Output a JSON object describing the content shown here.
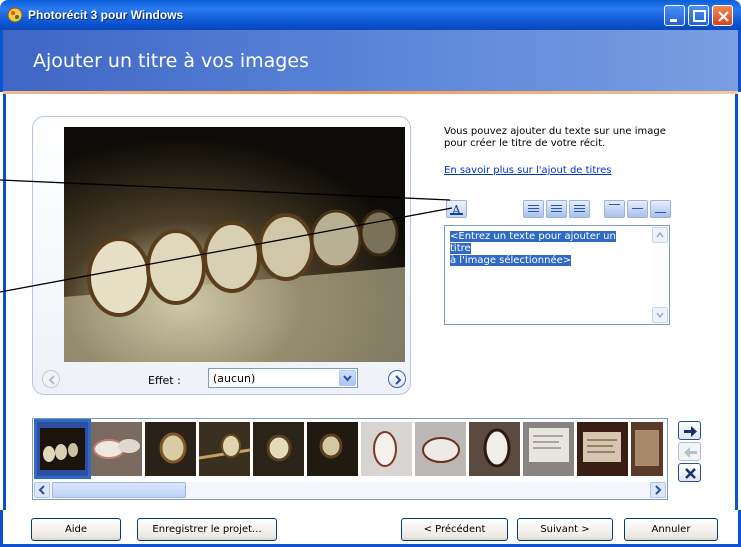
{
  "window": {
    "title": "Photorécit 3 pour Windows"
  },
  "header": {
    "title": "Ajouter un titre à vos images"
  },
  "right_panel": {
    "intro_line1": "Vous pouvez ajouter du texte sur une image",
    "intro_line2": "pour créer le titre de votre récit.",
    "learn_more_link": "En savoir plus sur l'ajout de titres",
    "textarea_text_line1": "<Entrez un texte pour ajouter un titre",
    "textarea_text_line2": "à l'image sélectionnée>"
  },
  "preview": {
    "effect_label": "Effet :",
    "effect_value": "(aucun)"
  },
  "filmstrip": {
    "thumb_count": 11,
    "selected_index": 0
  },
  "buttons": {
    "help": "Aide",
    "save_project": "Enregistrer le projet...",
    "previous": "< Précédent",
    "next": "Suivant >",
    "cancel": "Annuler"
  },
  "colors": {
    "title_bar": "#0b52cf",
    "header": "#5a84d8",
    "accent_line": "#f39a54",
    "selection": "#316ac5"
  }
}
